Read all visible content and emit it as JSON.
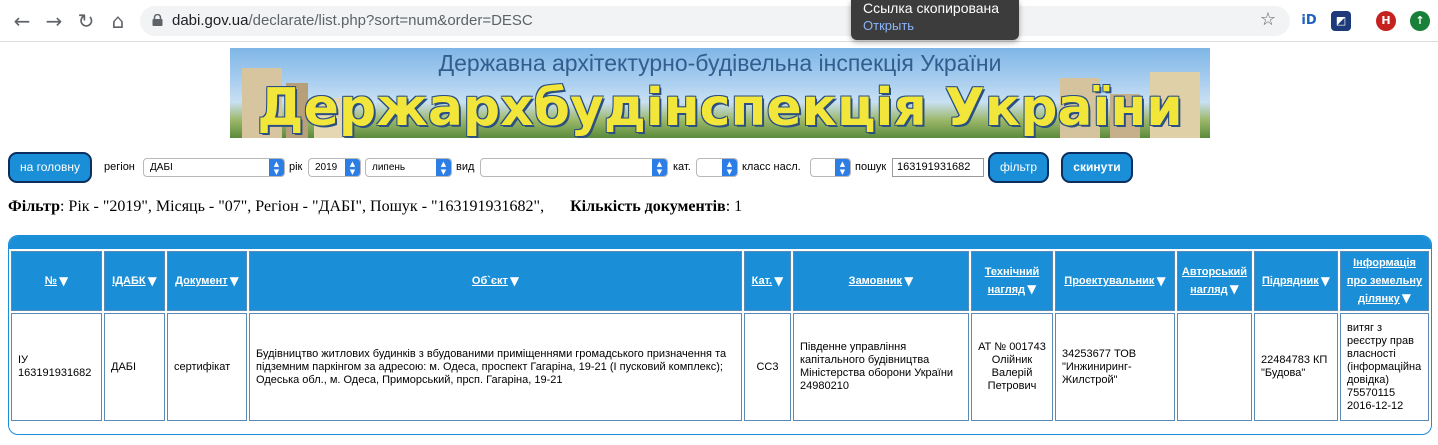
{
  "browser": {
    "url_host": "dabi.gov.ua",
    "url_path": "/declarate/list.php?sort=num&order=DESC",
    "toast_title": "Ссылка скопирована",
    "toast_link": "Открыть",
    "profile_initial": "H"
  },
  "banner": {
    "subtitle": "Державна архітектурно-будівельна інспекція України",
    "title": "Держархбудінспекція України"
  },
  "filters": {
    "home_button": "на головну",
    "region_label": "регіон",
    "region_value": "ДАБІ",
    "year_label": "рік",
    "year_value": "2019",
    "month_value": "липень",
    "kind_label": "вид",
    "kind_value": "",
    "cat_label": "кат.",
    "cat_value": "",
    "class_label": "класс насл.",
    "class_value": "",
    "search_label": "пошук",
    "search_value": "163191931682",
    "filter_button": "фільтр",
    "reset_button": "скинути"
  },
  "summary": {
    "filter_label": "Фільтр",
    "filter_text": ": Рік - \"2019\", Місяць - \"07\", Регіон - \"ДАБІ\", Пошук - \"163191931682\",",
    "count_label": "Кількість документів",
    "count_value": ": 1"
  },
  "table": {
    "headers": {
      "num": "№",
      "idabk": "ІДАБК",
      "doc": "Документ",
      "object": "Об`єкт",
      "cat": "Кат.",
      "customer": "Замовник",
      "tech1": "Технічний",
      "tech2": "нагляд",
      "designer": "Проектувальник",
      "author1": "Авторський",
      "author2": "нагляд",
      "contractor": "Підрядник",
      "land1": "Інформація",
      "land2": "про земельну",
      "land3": "ділянку"
    },
    "row": {
      "num1": "ІУ",
      "num2": "163191931682",
      "idabk": "ДАБІ",
      "doc": "сертифікат",
      "object": "Будівництво житлових будинків з вбудованими приміщеннями громадського призначення та підземним паркінгом за адресою: м. Одеса, проспект Гагаріна, 19-21 (І пусковий комплекс); Одеська обл., м. Одеса, Приморський, прсп. Гагаріна, 19-21",
      "cat": "СС3",
      "customer": "Південне управління капітального будівництва Міністерства оборони України 24980210",
      "tech": "АТ № 001743 Олійник Валерій Петрович",
      "designer": "34253677 ТОВ \"Инжиниринг-Жилстрой\"",
      "author": "",
      "contractor": "22484783 КП \"Будова\"",
      "land": "витяг з реєстру прав власності (інформаційна довідка) 75570115 2016-12-12"
    }
  },
  "colors": {
    "accent": "#1a8fd8",
    "button_border": "#0b2e5e",
    "select_arrow": "#2c7de6"
  }
}
